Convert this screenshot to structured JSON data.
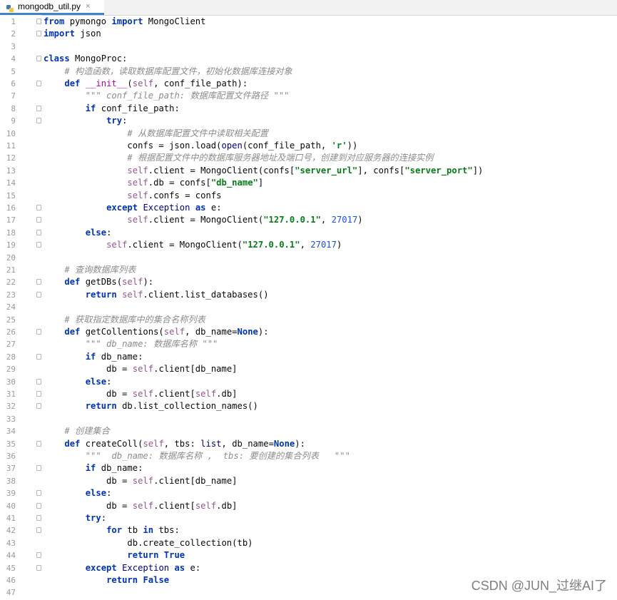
{
  "tab": {
    "filename": "mongodb_util.py",
    "close_glyph": "×",
    "icon": "python-file-icon"
  },
  "watermark": "CSDN @JUN_过继AI了",
  "lines": [
    {
      "n": "1",
      "fold": true,
      "t": [
        {
          "c": "kw",
          "v": "from"
        },
        {
          "c": "",
          "v": " pymongo "
        },
        {
          "c": "kw",
          "v": "import"
        },
        {
          "c": "",
          "v": " MongoClient"
        }
      ]
    },
    {
      "n": "2",
      "fold": true,
      "t": [
        {
          "c": "kw",
          "v": "import"
        },
        {
          "c": "",
          "v": " json"
        }
      ]
    },
    {
      "n": "3",
      "t": []
    },
    {
      "n": "4",
      "fold": true,
      "t": [
        {
          "c": "kw",
          "v": "class"
        },
        {
          "c": "",
          "v": " MongoProc:"
        }
      ]
    },
    {
      "n": "5",
      "t": [
        {
          "c": "",
          "v": "    "
        },
        {
          "c": "cm",
          "v": "# 构造函数，读取数据库配置文件，初始化数据库连接对象"
        }
      ]
    },
    {
      "n": "6",
      "fold": true,
      "t": [
        {
          "c": "",
          "v": "    "
        },
        {
          "c": "kw",
          "v": "def"
        },
        {
          "c": "",
          "v": " "
        },
        {
          "c": "mg",
          "v": "__init__"
        },
        {
          "c": "",
          "v": "("
        },
        {
          "c": "sf",
          "v": "self"
        },
        {
          "c": "",
          "v": ", conf_file_path):"
        }
      ]
    },
    {
      "n": "7",
      "t": [
        {
          "c": "",
          "v": "        "
        },
        {
          "c": "ds",
          "v": "\"\"\" conf_file_path: 数据库配置文件路径 \"\"\""
        }
      ]
    },
    {
      "n": "8",
      "fold": true,
      "t": [
        {
          "c": "",
          "v": "        "
        },
        {
          "c": "kw",
          "v": "if"
        },
        {
          "c": "",
          "v": " conf_file_path:"
        }
      ]
    },
    {
      "n": "9",
      "fold": true,
      "t": [
        {
          "c": "",
          "v": "            "
        },
        {
          "c": "kw",
          "v": "try"
        },
        {
          "c": "",
          "v": ":"
        }
      ]
    },
    {
      "n": "10",
      "t": [
        {
          "c": "",
          "v": "                "
        },
        {
          "c": "cm",
          "v": "# 从数据库配置文件中读取相关配置"
        }
      ]
    },
    {
      "n": "11",
      "t": [
        {
          "c": "",
          "v": "                confs = json.load("
        },
        {
          "c": "bi",
          "v": "open"
        },
        {
          "c": "",
          "v": "(conf_file_path, "
        },
        {
          "c": "st",
          "v": "'r'"
        },
        {
          "c": "",
          "v": "))"
        }
      ]
    },
    {
      "n": "12",
      "t": [
        {
          "c": "",
          "v": "                "
        },
        {
          "c": "cm",
          "v": "# 根据配置文件中的数据库服务器地址及端口号，创建到对应服务器的连接实例"
        }
      ]
    },
    {
      "n": "13",
      "t": [
        {
          "c": "",
          "v": "                "
        },
        {
          "c": "sf",
          "v": "self"
        },
        {
          "c": "",
          "v": ".client = MongoClient(confs["
        },
        {
          "c": "st",
          "v": "\"server_url\""
        },
        {
          "c": "",
          "v": "], confs["
        },
        {
          "c": "st",
          "v": "\"server_port\""
        },
        {
          "c": "",
          "v": "])"
        }
      ]
    },
    {
      "n": "14",
      "t": [
        {
          "c": "",
          "v": "                "
        },
        {
          "c": "sf",
          "v": "self"
        },
        {
          "c": "",
          "v": ".db = confs["
        },
        {
          "c": "st",
          "v": "\"db_name\""
        },
        {
          "c": "",
          "v": "]"
        }
      ]
    },
    {
      "n": "15",
      "t": [
        {
          "c": "",
          "v": "                "
        },
        {
          "c": "sf",
          "v": "self"
        },
        {
          "c": "",
          "v": ".confs = confs"
        }
      ]
    },
    {
      "n": "16",
      "fold": true,
      "t": [
        {
          "c": "",
          "v": "            "
        },
        {
          "c": "kw",
          "v": "except"
        },
        {
          "c": "",
          "v": " "
        },
        {
          "c": "bi",
          "v": "Exception"
        },
        {
          "c": "",
          "v": " "
        },
        {
          "c": "kw",
          "v": "as"
        },
        {
          "c": "",
          "v": " e:"
        }
      ]
    },
    {
      "n": "17",
      "fold": true,
      "t": [
        {
          "c": "",
          "v": "                "
        },
        {
          "c": "sf",
          "v": "self"
        },
        {
          "c": "",
          "v": ".client = MongoClient("
        },
        {
          "c": "st",
          "v": "\"127.0.0.1\""
        },
        {
          "c": "",
          "v": ", "
        },
        {
          "c": "nu",
          "v": "27017"
        },
        {
          "c": "",
          "v": ")"
        }
      ]
    },
    {
      "n": "18",
      "fold": true,
      "t": [
        {
          "c": "",
          "v": "        "
        },
        {
          "c": "kw",
          "v": "else"
        },
        {
          "c": "",
          "v": ":"
        }
      ]
    },
    {
      "n": "19",
      "fold": true,
      "t": [
        {
          "c": "",
          "v": "            "
        },
        {
          "c": "sf",
          "v": "self"
        },
        {
          "c": "",
          "v": ".client = MongoClient("
        },
        {
          "c": "st",
          "v": "\"127.0.0.1\""
        },
        {
          "c": "",
          "v": ", "
        },
        {
          "c": "nu",
          "v": "27017"
        },
        {
          "c": "",
          "v": ")"
        }
      ]
    },
    {
      "n": "20",
      "t": []
    },
    {
      "n": "21",
      "t": [
        {
          "c": "",
          "v": "    "
        },
        {
          "c": "cm",
          "v": "# 查询数据库列表"
        }
      ]
    },
    {
      "n": "22",
      "fold": true,
      "t": [
        {
          "c": "",
          "v": "    "
        },
        {
          "c": "kw",
          "v": "def"
        },
        {
          "c": "",
          "v": " getDBs("
        },
        {
          "c": "sf",
          "v": "self"
        },
        {
          "c": "",
          "v": "):"
        }
      ]
    },
    {
      "n": "23",
      "fold": true,
      "t": [
        {
          "c": "",
          "v": "        "
        },
        {
          "c": "kw",
          "v": "return"
        },
        {
          "c": "",
          "v": " "
        },
        {
          "c": "sf",
          "v": "self"
        },
        {
          "c": "",
          "v": ".client.list_databases()"
        }
      ]
    },
    {
      "n": "24",
      "t": []
    },
    {
      "n": "25",
      "t": [
        {
          "c": "",
          "v": "    "
        },
        {
          "c": "cm",
          "v": "# 获取指定数据库中的集合名称列表"
        }
      ]
    },
    {
      "n": "26",
      "fold": true,
      "t": [
        {
          "c": "",
          "v": "    "
        },
        {
          "c": "kw",
          "v": "def"
        },
        {
          "c": "",
          "v": " getCollentions("
        },
        {
          "c": "sf",
          "v": "self"
        },
        {
          "c": "",
          "v": ", db_name="
        },
        {
          "c": "kw",
          "v": "None"
        },
        {
          "c": "",
          "v": "):"
        }
      ]
    },
    {
      "n": "27",
      "t": [
        {
          "c": "",
          "v": "        "
        },
        {
          "c": "ds",
          "v": "\"\"\" db_name: 数据库名称 \"\"\""
        }
      ]
    },
    {
      "n": "28",
      "fold": true,
      "t": [
        {
          "c": "",
          "v": "        "
        },
        {
          "c": "kw",
          "v": "if"
        },
        {
          "c": "",
          "v": " db_name:"
        }
      ]
    },
    {
      "n": "29",
      "t": [
        {
          "c": "",
          "v": "            db = "
        },
        {
          "c": "sf",
          "v": "self"
        },
        {
          "c": "",
          "v": ".client[db_name]"
        }
      ]
    },
    {
      "n": "30",
      "fold": true,
      "t": [
        {
          "c": "",
          "v": "        "
        },
        {
          "c": "kw",
          "v": "else"
        },
        {
          "c": "",
          "v": ":"
        }
      ]
    },
    {
      "n": "31",
      "fold": true,
      "t": [
        {
          "c": "",
          "v": "            db = "
        },
        {
          "c": "sf",
          "v": "self"
        },
        {
          "c": "",
          "v": ".client["
        },
        {
          "c": "sf",
          "v": "self"
        },
        {
          "c": "",
          "v": ".db]"
        }
      ]
    },
    {
      "n": "32",
      "fold": true,
      "t": [
        {
          "c": "",
          "v": "        "
        },
        {
          "c": "kw",
          "v": "return"
        },
        {
          "c": "",
          "v": " db.list_collection_names()"
        }
      ]
    },
    {
      "n": "33",
      "t": []
    },
    {
      "n": "34",
      "t": [
        {
          "c": "",
          "v": "    "
        },
        {
          "c": "cm",
          "v": "# 创建集合"
        }
      ]
    },
    {
      "n": "35",
      "fold": true,
      "t": [
        {
          "c": "",
          "v": "    "
        },
        {
          "c": "kw",
          "v": "def"
        },
        {
          "c": "",
          "v": " createColl("
        },
        {
          "c": "sf",
          "v": "self"
        },
        {
          "c": "",
          "v": ", tbs: "
        },
        {
          "c": "bi",
          "v": "list"
        },
        {
          "c": "",
          "v": ", db_name="
        },
        {
          "c": "kw",
          "v": "None"
        },
        {
          "c": "",
          "v": "):"
        }
      ]
    },
    {
      "n": "36",
      "t": [
        {
          "c": "",
          "v": "        "
        },
        {
          "c": "ds",
          "v": "\"\"\"  db_name: 数据库名称 ,  tbs: 要创建的集合列表   \"\"\""
        }
      ]
    },
    {
      "n": "37",
      "fold": true,
      "t": [
        {
          "c": "",
          "v": "        "
        },
        {
          "c": "kw",
          "v": "if"
        },
        {
          "c": "",
          "v": " db_name:"
        }
      ]
    },
    {
      "n": "38",
      "t": [
        {
          "c": "",
          "v": "            db = "
        },
        {
          "c": "sf",
          "v": "self"
        },
        {
          "c": "",
          "v": ".client[db_name]"
        }
      ]
    },
    {
      "n": "39",
      "fold": true,
      "t": [
        {
          "c": "",
          "v": "        "
        },
        {
          "c": "kw",
          "v": "else"
        },
        {
          "c": "",
          "v": ":"
        }
      ]
    },
    {
      "n": "40",
      "fold": true,
      "t": [
        {
          "c": "",
          "v": "            db = "
        },
        {
          "c": "sf",
          "v": "self"
        },
        {
          "c": "",
          "v": ".client["
        },
        {
          "c": "sf",
          "v": "self"
        },
        {
          "c": "",
          "v": ".db]"
        }
      ]
    },
    {
      "n": "41",
      "fold": true,
      "t": [
        {
          "c": "",
          "v": "        "
        },
        {
          "c": "kw",
          "v": "try"
        },
        {
          "c": "",
          "v": ":"
        }
      ]
    },
    {
      "n": "42",
      "fold": true,
      "t": [
        {
          "c": "",
          "v": "            "
        },
        {
          "c": "kw",
          "v": "for"
        },
        {
          "c": "",
          "v": " tb "
        },
        {
          "c": "kw",
          "v": "in"
        },
        {
          "c": "",
          "v": " tbs:"
        }
      ]
    },
    {
      "n": "43",
      "t": [
        {
          "c": "",
          "v": "                db.create_collection(tb)"
        }
      ]
    },
    {
      "n": "44",
      "fold": true,
      "t": [
        {
          "c": "",
          "v": "                "
        },
        {
          "c": "kw",
          "v": "return"
        },
        {
          "c": "",
          "v": " "
        },
        {
          "c": "kw",
          "v": "True"
        }
      ]
    },
    {
      "n": "45",
      "fold": true,
      "t": [
        {
          "c": "",
          "v": "        "
        },
        {
          "c": "kw",
          "v": "except"
        },
        {
          "c": "",
          "v": " "
        },
        {
          "c": "bi",
          "v": "Exception"
        },
        {
          "c": "",
          "v": " "
        },
        {
          "c": "kw",
          "v": "as"
        },
        {
          "c": "",
          "v": " e:"
        }
      ]
    },
    {
      "n": "46",
      "t": [
        {
          "c": "",
          "v": "            "
        },
        {
          "c": "kw",
          "v": "return"
        },
        {
          "c": "",
          "v": " "
        },
        {
          "c": "kw",
          "v": "False"
        }
      ]
    },
    {
      "n": "47",
      "t": []
    }
  ]
}
